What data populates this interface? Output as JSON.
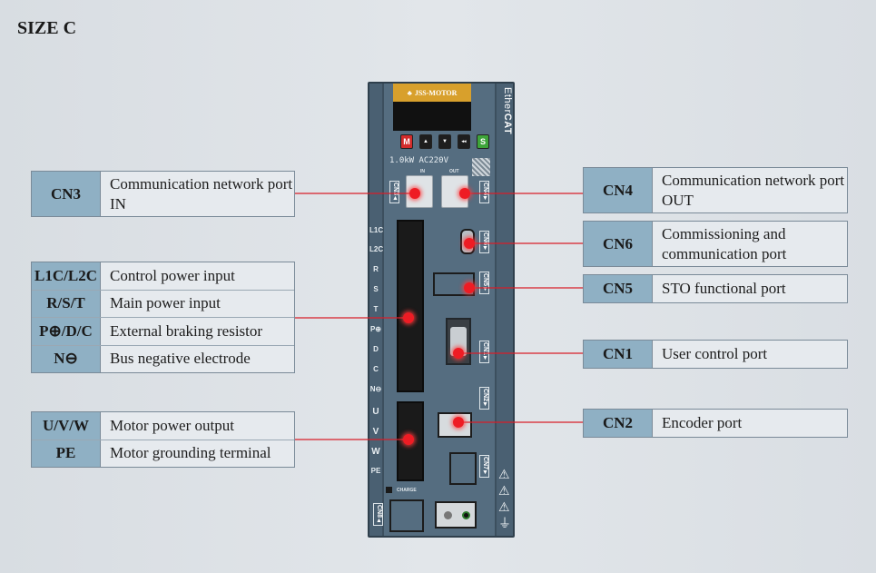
{
  "title": "SIZE C",
  "device": {
    "brand": "JSS-MOTOR",
    "bus_logo_prefix": "Ether",
    "bus_logo_suffix": "CAT",
    "rating": "1.0kW AC220V",
    "port_in_label": "IN",
    "port_out_label": "OUT",
    "charge_label": "CHARGE",
    "keypad": [
      {
        "label": "M",
        "color": "#d32c2c",
        "icon": "mode-key"
      },
      {
        "label": "▲",
        "color": "#1e1e1e",
        "icon": "up-arrow-key"
      },
      {
        "label": "▼",
        "color": "#1e1e1e",
        "icon": "down-arrow-key"
      },
      {
        "label": "◂◂",
        "color": "#1e1e1e",
        "icon": "shift-key"
      },
      {
        "label": "S",
        "color": "#3ea43a",
        "icon": "set-key"
      }
    ],
    "connector_tags": {
      "cn3": "CN3▲",
      "cn4": "CN4▼",
      "cn6": "CN6▼",
      "cn5": "CN5▼",
      "cn1": "CN1▼",
      "cn2": "CN2▼",
      "cn7": "CN7▼",
      "cn8": "CN8▲"
    },
    "power_terminal_labels": [
      "L1C",
      "L2C",
      "R",
      "S",
      "T",
      "P⊕",
      "D",
      "C",
      "N⊖"
    ],
    "motor_terminal_labels": [
      "U",
      "V",
      "W",
      "PE"
    ],
    "warning_icons": [
      "⚠",
      "⚠",
      "⚠",
      "⏚"
    ]
  },
  "left_labels": [
    {
      "rows": [
        {
          "key": "CN3",
          "value": "Communication network port IN"
        }
      ]
    },
    {
      "rows": [
        {
          "key": "L1C/L2C",
          "value": "Control power input"
        },
        {
          "key": "R/S/T",
          "value": "Main power input"
        },
        {
          "key": "P⊕/D/C",
          "value": "External braking resistor"
        },
        {
          "key": "N⊖",
          "value": "Bus negative electrode"
        }
      ]
    },
    {
      "rows": [
        {
          "key": "U/V/W",
          "value": "Motor power output"
        },
        {
          "key": "PE",
          "value": "Motor grounding terminal"
        }
      ]
    }
  ],
  "right_labels": [
    {
      "key": "CN4",
      "value": "Communication network port OUT"
    },
    {
      "key": "CN6",
      "value": "Commissioning and communication port"
    },
    {
      "key": "CN5",
      "value": "STO functional port"
    },
    {
      "key": "CN1",
      "value": "User control port"
    },
    {
      "key": "CN2",
      "value": "Encoder port"
    }
  ],
  "colors": {
    "key_cell": "#8fb0c4",
    "leader_line": "#d81e28",
    "device_body": "#4a6072",
    "brand_plate": "#d8a02c"
  }
}
